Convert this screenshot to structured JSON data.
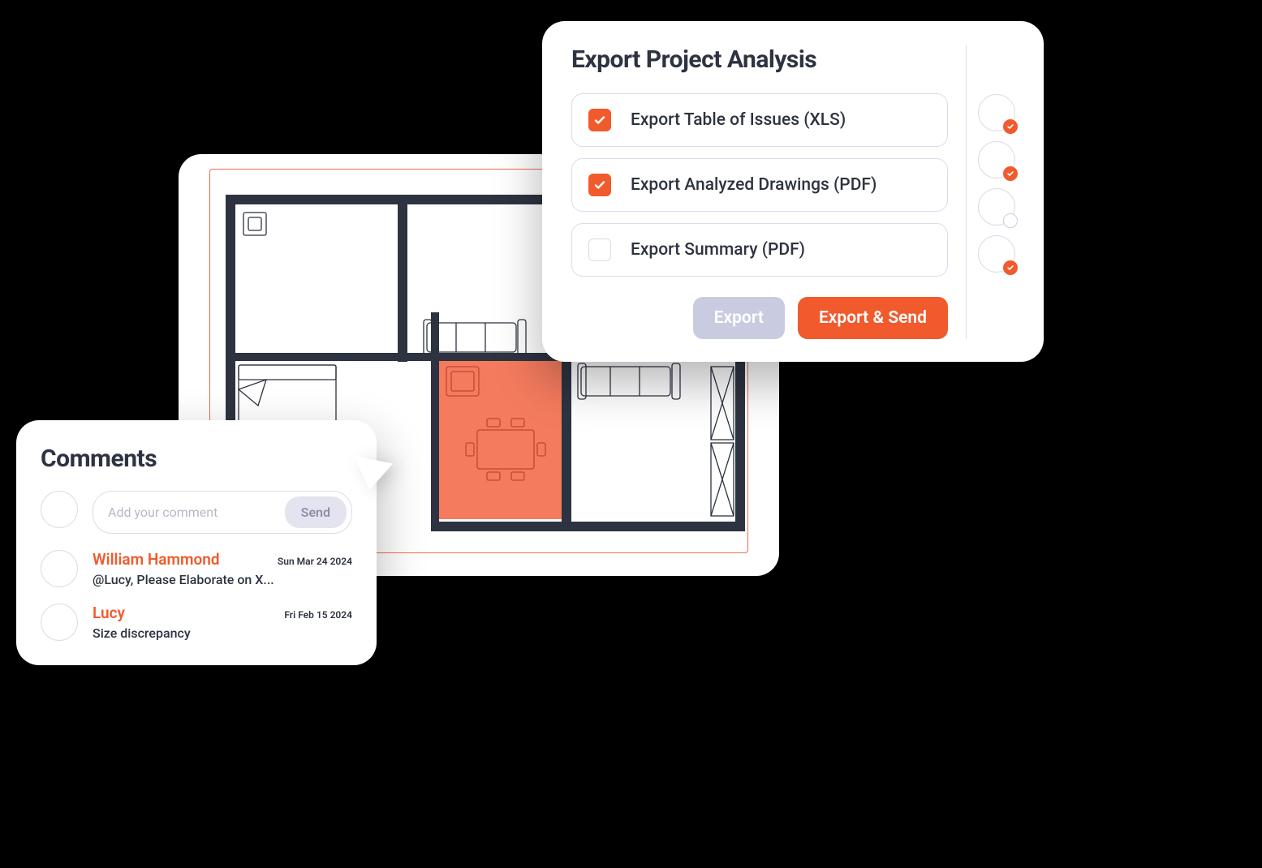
{
  "export": {
    "title": "Export Project Analysis",
    "options": [
      {
        "label": "Export Table of Issues (XLS)",
        "checked": true
      },
      {
        "label": "Export Analyzed Drawings (PDF)",
        "checked": true
      },
      {
        "label": "Export Summary (PDF)",
        "checked": false
      }
    ],
    "buttons": {
      "secondary": "Export",
      "primary": "Export & Send"
    },
    "thumbs": [
      {
        "status": "orange"
      },
      {
        "status": "orange"
      },
      {
        "status": "gray"
      },
      {
        "status": "orange"
      }
    ]
  },
  "comments": {
    "title": "Comments",
    "input_placeholder": "Add your comment",
    "send_label": "Send",
    "items": [
      {
        "author": "William Hammond",
        "date": "Sun Mar 24 2024",
        "text": "@Lucy, Please Elaborate on X..."
      },
      {
        "author": "Lucy",
        "date": "Fri Feb 15 2024",
        "text": "Size discrepancy"
      }
    ]
  },
  "colors": {
    "accent": "#f15a2c",
    "highlight": "#f47b5e"
  }
}
